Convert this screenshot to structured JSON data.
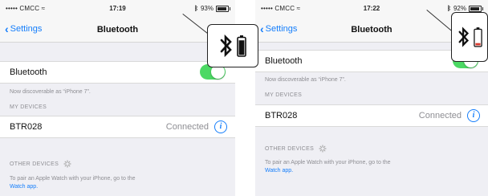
{
  "screens": [
    {
      "status": {
        "carrier": "••••• CMCC ≈",
        "time": "17:19",
        "battery": "93%",
        "battery_level": 0.93
      },
      "nav": {
        "back": "Settings",
        "title": "Bluetooth"
      },
      "bluetooth": {
        "label": "Bluetooth",
        "on": true
      },
      "discoverable": "Now discoverable as “iPhone 7”.",
      "my_devices_header": "MY DEVICES",
      "device": {
        "name": "BTR028",
        "status": "Connected",
        "info_icon": "info-icon"
      },
      "other_devices_header": "OTHER DEVICES",
      "pair_text": "To pair an Apple Watch with your iPhone, go to the",
      "pair_link": "Watch app."
    },
    {
      "status": {
        "carrier": "••••• CMCC ≈",
        "time": "17:22",
        "battery": "92%",
        "battery_level": 0.92
      },
      "nav": {
        "back": "Settings",
        "title": "Bluetooth"
      },
      "bluetooth": {
        "label": "Bluetooth",
        "on": true
      },
      "discoverable": "Now discoverable as “iPhone 7”.",
      "my_devices_header": "MY DEVICES",
      "device": {
        "name": "BTR028",
        "status": "Connected",
        "info_icon": "info-icon"
      },
      "other_devices_header": "OTHER DEVICES",
      "pair_text": "To pair an Apple Watch with your iPhone, go to the",
      "pair_link": "Watch app."
    }
  ],
  "callouts": [
    {
      "icon": "bluetooth-battery-icon",
      "battery_color": "#111111",
      "battery_level": 0.9
    },
    {
      "icon": "bluetooth-battery-icon",
      "battery_color": "#d83a2e",
      "battery_level": 0.15
    }
  ],
  "colors": {
    "accent": "#157efb",
    "toggle_on": "#4cd964"
  }
}
